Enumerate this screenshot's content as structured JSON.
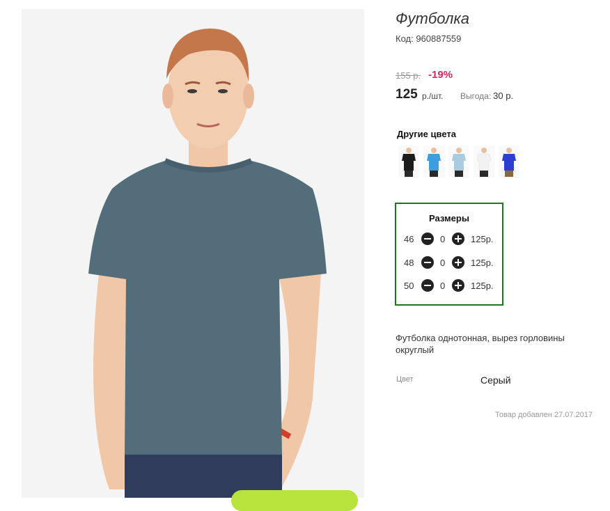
{
  "product": {
    "title": "Футболка",
    "code": "Код: 960887559",
    "old_price": "155 р.",
    "discount": "-19%",
    "price": "125",
    "price_unit": "р./шт.",
    "benefit_label": "Выгода:",
    "benefit_value": "30 р."
  },
  "other_colors": {
    "heading": "Другие цвета",
    "swatches": [
      {
        "color": "#1c1c1c"
      },
      {
        "color": "#3b9ee0"
      },
      {
        "color": "#a9cbe0"
      },
      {
        "color": "#f2f2f2"
      },
      {
        "color": "#2c3fd1"
      }
    ]
  },
  "sizes": {
    "heading": "Размеры",
    "rows": [
      {
        "size": "46",
        "qty": "0",
        "price": "125р."
      },
      {
        "size": "48",
        "qty": "0",
        "price": "125р."
      },
      {
        "size": "50",
        "qty": "0",
        "price": "125р."
      }
    ]
  },
  "description": "Футболка однотонная, вырез горловины округлый",
  "attributes": {
    "color_label": "Цвет",
    "color_value": "Серый"
  },
  "added": "Товар добавлен 27.07.2017",
  "colors": {
    "tshirt": "#536d7b",
    "size_border": "#1a7a1a",
    "discount": "#e0245e",
    "cart_button": "#b8e23c"
  }
}
